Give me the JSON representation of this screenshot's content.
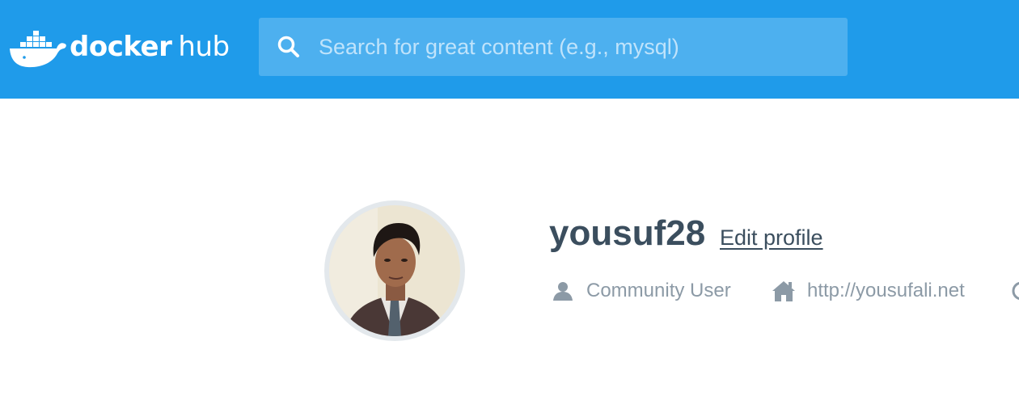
{
  "header": {
    "logo": {
      "word1": "docker",
      "word2": "hub",
      "icon": "docker-whale-icon"
    },
    "search": {
      "placeholder": "Search for great content (e.g., mysql)",
      "value": "",
      "icon": "search-icon"
    },
    "colors": {
      "bar": "#1f9bea",
      "search_bg": "#4db0ef"
    }
  },
  "profile": {
    "username": "yousuf28",
    "edit_label": "Edit profile",
    "avatar": "profile-photo",
    "account_type": {
      "icon": "user-icon",
      "label": "Community User"
    },
    "website": {
      "icon": "home-icon",
      "label": "http://yousufali.net"
    },
    "extra_icon": "clock-icon",
    "colors": {
      "name": "#3b4e5e",
      "meta": "#8c9aa6"
    }
  }
}
